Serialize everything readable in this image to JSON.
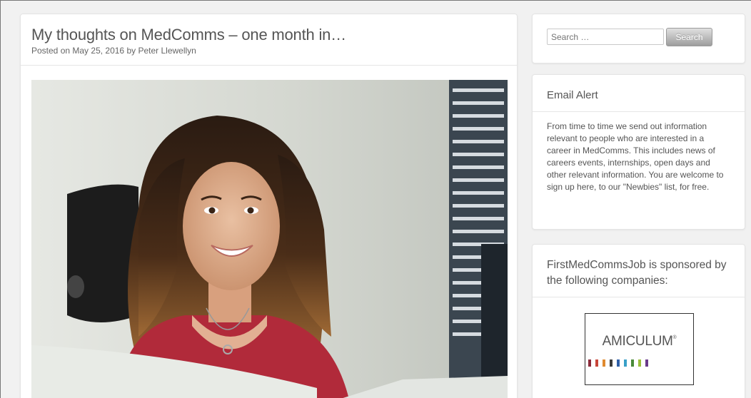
{
  "article": {
    "title": "My thoughts on MedComms – one month in…",
    "posted_prefix": "Posted on",
    "date": "May 25, 2016",
    "by": "by",
    "author": "Peter Llewellyn"
  },
  "search": {
    "placeholder": "Search …",
    "button_label": "Search"
  },
  "email_alert": {
    "title": "Email Alert",
    "text": "From time to time we send out information relevant to people who are interested in a career in MedComms. This includes news of careers events, internships, open days and other relevant information. You are welcome to sign up here, to our \"Newbies\" list, for free."
  },
  "sponsors": {
    "title": "FirstMedCommsJob is sponsored by the following companies:",
    "logo": {
      "name": "AMICULUM",
      "mark": "®",
      "bar_colors": [
        "#8b2a3a",
        "#c8463a",
        "#e08a2f",
        "#3b3b3b",
        "#2e5fa8",
        "#39a0c8",
        "#4a8a3a",
        "#9cbf3a",
        "#6a3a8a"
      ]
    }
  }
}
